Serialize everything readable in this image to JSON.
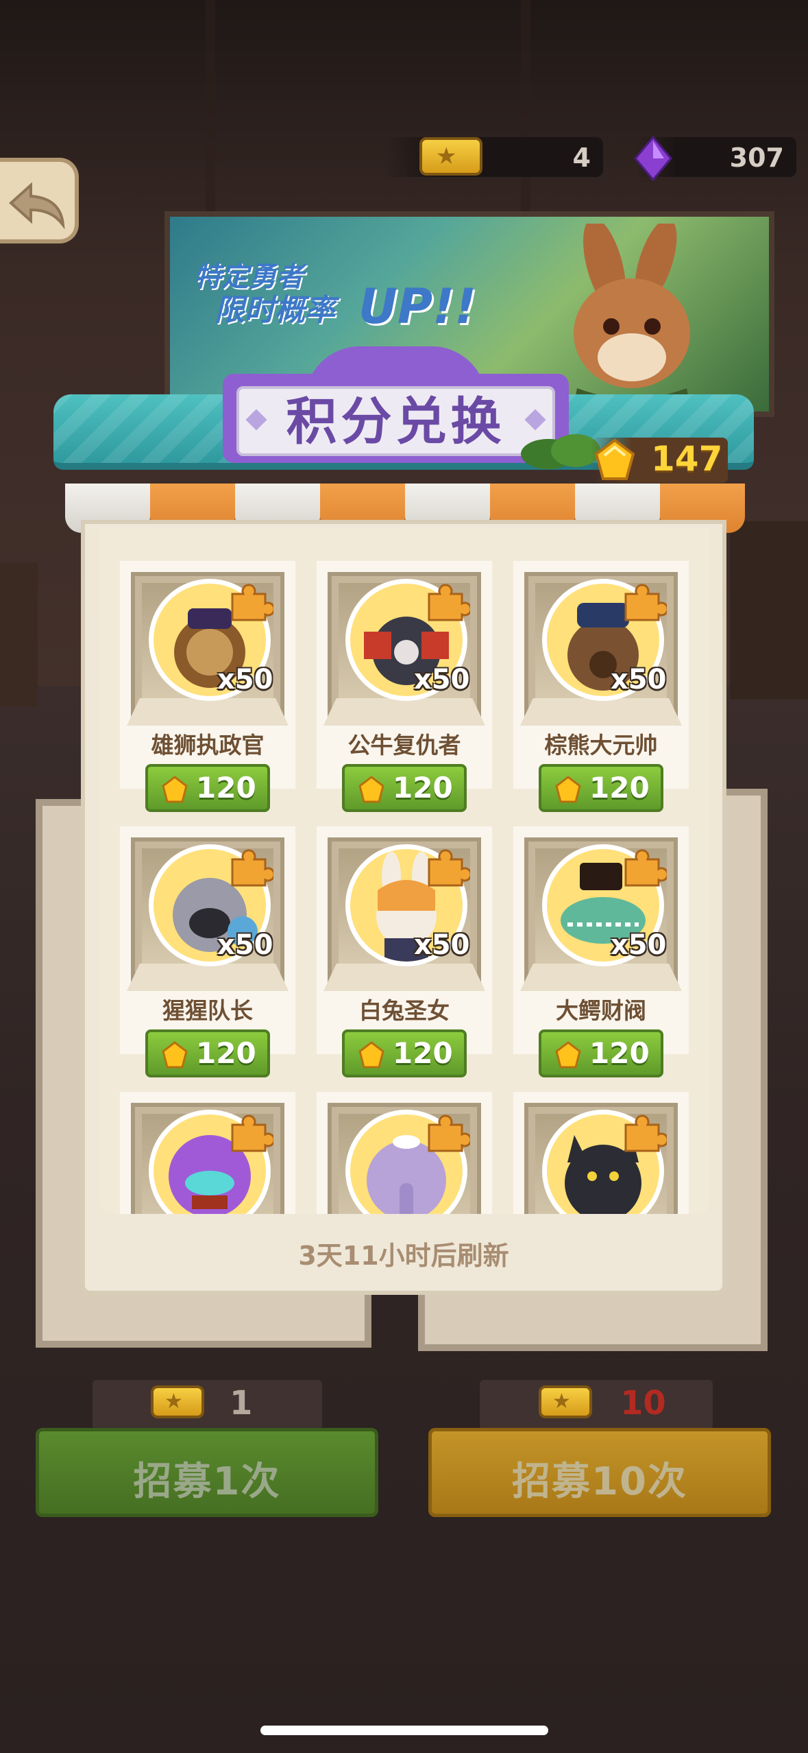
{
  "hud": {
    "tickets": "4",
    "gems": "307"
  },
  "banner": {
    "line1": "特定勇者",
    "line2": "限时概率",
    "highlight": "UP!!"
  },
  "shop": {
    "title": "积分兑换",
    "points": "147",
    "refresh_text": "3天11小时后刷新",
    "items": [
      {
        "name": "雄狮执政官",
        "qty": "x50",
        "price": "120",
        "icon": "lion-portrait-icon",
        "color": "#ffd65a"
      },
      {
        "name": "公牛复仇者",
        "qty": "x50",
        "price": "120",
        "icon": "bull-portrait-icon",
        "color": "#ffd65a"
      },
      {
        "name": "棕熊大元帅",
        "qty": "x50",
        "price": "120",
        "icon": "bear-portrait-icon",
        "color": "#ffd65a"
      },
      {
        "name": "猩猩队长",
        "qty": "x50",
        "price": "120",
        "icon": "gorilla-portrait-icon",
        "color": "#ffd65a"
      },
      {
        "name": "白兔圣女",
        "qty": "x50",
        "price": "120",
        "icon": "rabbit-portrait-icon",
        "color": "#ffd65a"
      },
      {
        "name": "大鳄财阀",
        "qty": "x50",
        "price": "120",
        "icon": "crocodile-portrait-icon",
        "color": "#ffd65a"
      },
      {
        "name": "",
        "qty": "",
        "price": "",
        "icon": "octopus-portrait-icon",
        "color": "#ffd65a"
      },
      {
        "name": "",
        "qty": "",
        "price": "",
        "icon": "elephant-portrait-icon",
        "color": "#ffd65a"
      },
      {
        "name": "",
        "qty": "",
        "price": "",
        "icon": "panther-portrait-icon",
        "color": "#ffd65a"
      }
    ]
  },
  "recruit": {
    "single": {
      "cost": "1",
      "label": "招募1次"
    },
    "ten": {
      "cost": "10",
      "label": "招募10次"
    }
  },
  "colors": {
    "accent_purple": "#8e5fd0",
    "awning_teal": "#2f9a9f",
    "price_green": "#6fad2f",
    "recruit_green": "#4e7a27",
    "recruit_gold": "#b98824",
    "cost_red": "#b22a22"
  }
}
